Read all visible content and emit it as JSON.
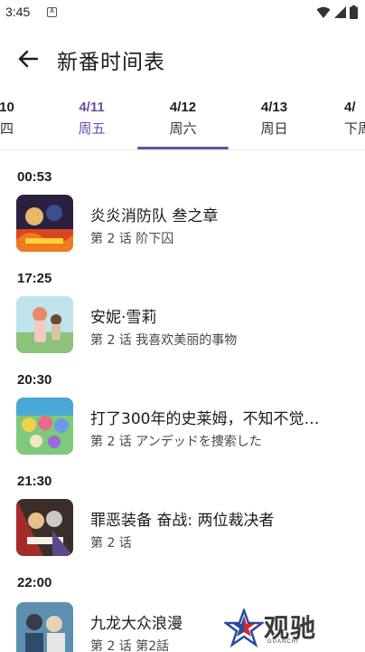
{
  "status_bar": {
    "time": "3:45",
    "notification_icon": "A"
  },
  "app_bar": {
    "title": "新番时间表"
  },
  "tabs": [
    {
      "date": "10",
      "weekday": "四"
    },
    {
      "date": "4/11",
      "weekday": "周五",
      "active": true
    },
    {
      "date": "4/12",
      "weekday": "周六"
    },
    {
      "date": "4/13",
      "weekday": "周日"
    },
    {
      "date": "4/",
      "weekday": "下周"
    }
  ],
  "schedule": [
    {
      "time": "00:53",
      "title": "炎炎消防队 叁之章",
      "subtitle": "第 2 话  阶下囚"
    },
    {
      "time": "17:25",
      "title": "安妮·雪莉",
      "subtitle": "第 2 话  我喜欢美丽的事物"
    },
    {
      "time": "20:30",
      "title": "打了300年的史莱姆，不知不觉…",
      "subtitle": "第 2 话  アンデッドを捜索した"
    },
    {
      "time": "21:30",
      "title": "罪恶装备 奋战: 两位裁决者",
      "subtitle": "第 2 话"
    },
    {
      "time": "22:00",
      "title": "九龙大众浪漫",
      "subtitle": "第 2 话  第2話"
    }
  ],
  "watermark": {
    "brand": "观驰",
    "sub": "GUANCHI"
  },
  "colors": {
    "accent": "#6750a4",
    "text": "#1c1b1f",
    "secondary_text": "#49454f"
  }
}
